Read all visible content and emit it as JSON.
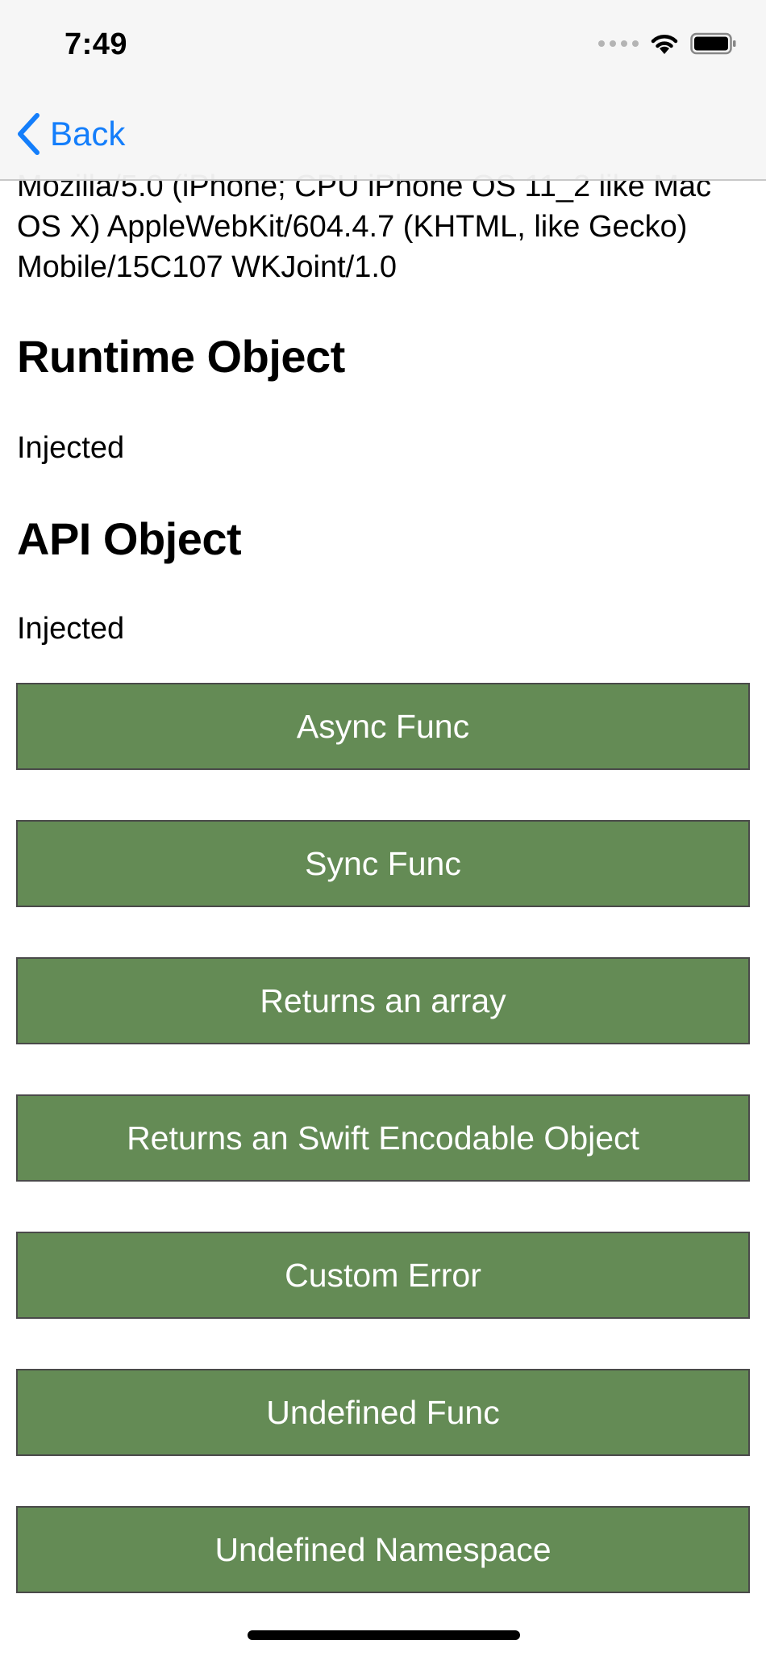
{
  "status_bar": {
    "time": "7:49"
  },
  "nav": {
    "back_label": "Back"
  },
  "content": {
    "user_agent": "Mozilla/5.0 (iPhone; CPU iPhone OS 11_2 like Mac OS X) AppleWebKit/604.4.7 (KHTML, like Gecko) Mobile/15C107 WKJoint/1.0",
    "runtime_title": "Runtime Object",
    "runtime_status": "Injected",
    "api_title": "API Object",
    "api_status": "Injected"
  },
  "buttons": [
    {
      "label": "Async Func"
    },
    {
      "label": "Sync Func"
    },
    {
      "label": "Returns an array"
    },
    {
      "label": "Returns an Swift Encodable Object"
    },
    {
      "label": "Custom Error"
    },
    {
      "label": "Undefined Func"
    },
    {
      "label": "Undefined Namespace"
    }
  ],
  "colors": {
    "button_fill": "#648b55",
    "button_border": "#4a4a4a",
    "tint": "#147efb"
  },
  "icons": [
    "chevron-left-icon",
    "cellular-signal-icon",
    "wifi-icon",
    "battery-icon"
  ]
}
